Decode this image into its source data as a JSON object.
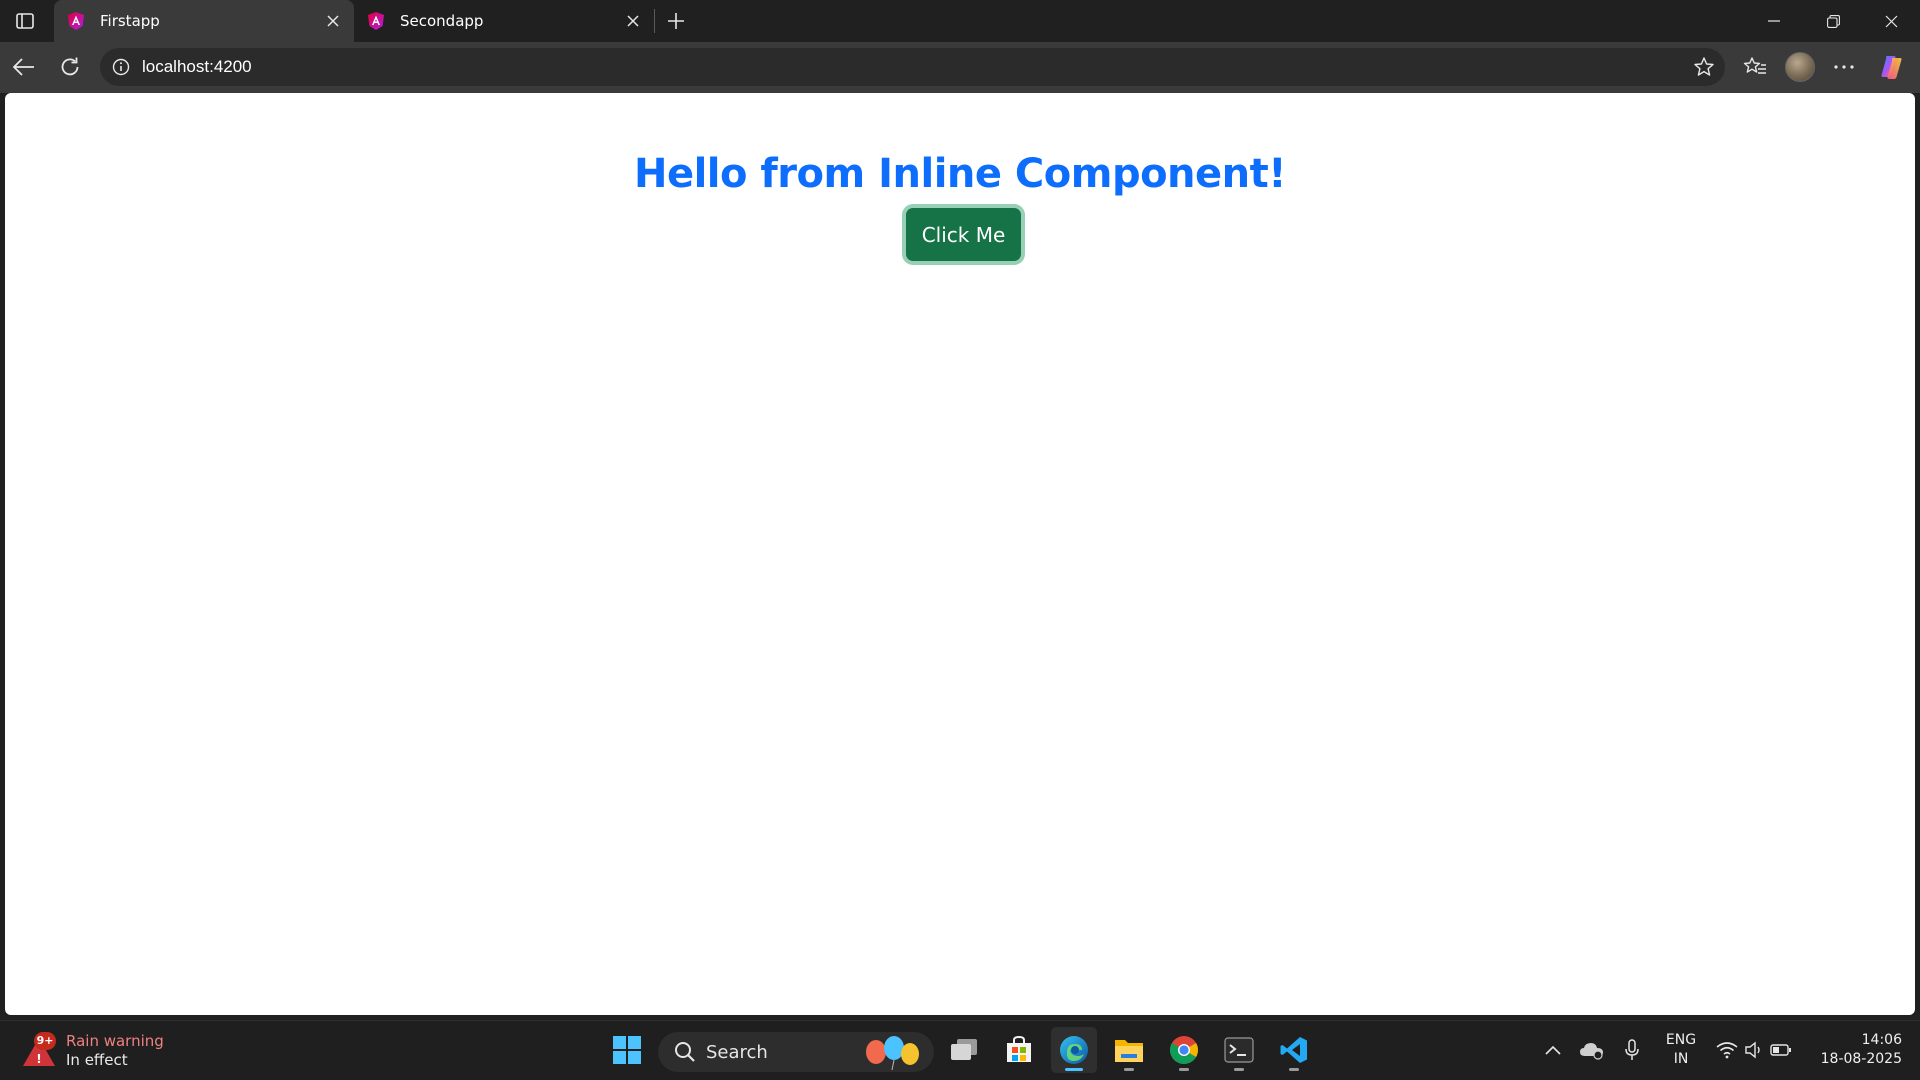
{
  "browser": {
    "tabs": [
      {
        "title": "Firstapp",
        "active": true
      },
      {
        "title": "Secondapp",
        "active": false
      }
    ],
    "address_url": "localhost:4200"
  },
  "page": {
    "heading": "Hello from Inline Component!",
    "button_label": "Click Me",
    "heading_color": "#0d6efd",
    "button_color": "#157347"
  },
  "taskbar": {
    "weather_title": "Rain warning",
    "weather_status": "In effect",
    "weather_badge": "9+",
    "search_label": "Search",
    "language_line1": "ENG",
    "language_line2": "IN",
    "time": "14:06",
    "date": "18-08-2025",
    "pinned_apps": [
      "task-view",
      "microsoft-store",
      "edge",
      "file-explorer",
      "chrome",
      "terminal",
      "vscode"
    ]
  }
}
